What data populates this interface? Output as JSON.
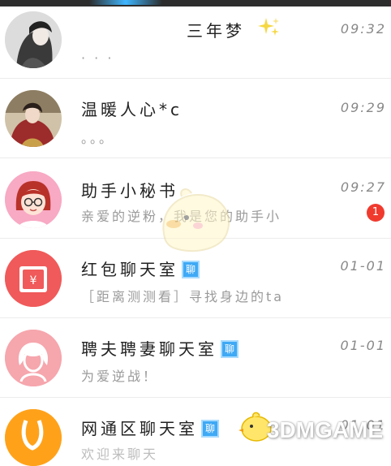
{
  "chats": [
    {
      "name": "三年梦",
      "time": "09:32",
      "preview": "· · ·",
      "name_icon": "sparkle-icon"
    },
    {
      "name": "温暖人心*c",
      "time": "09:29",
      "preview": "。。。"
    },
    {
      "name": "助手小秘书",
      "time": "09:27",
      "preview": "亲爱的逆粉，我是您的助手小",
      "unread": "1"
    },
    {
      "name": "红包聊天室",
      "time": "01-01",
      "preview": "［距离测测看］寻找身边的ta",
      "tag": "聊"
    },
    {
      "name": "聘夫聘妻聊天室",
      "time": "01-01",
      "preview": "为爱逆战！",
      "tag": "聊"
    },
    {
      "name": "网通区聊天室",
      "time": "01-01",
      "preview": "欢迎来聊天",
      "tag": "聊"
    }
  ],
  "watermark": "3DMGAME",
  "colors": {
    "unread_badge": "#f03a2e",
    "tag_bg": "#3fa9f5",
    "red_avatar": "#f05a5a",
    "pink_avatar": "#f6a6ad",
    "orange_avatar": "#ffa21a"
  }
}
